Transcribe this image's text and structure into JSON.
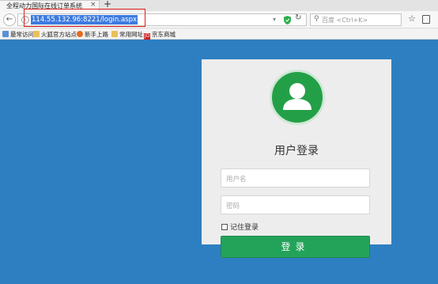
{
  "browser": {
    "tab_title": "全程动力国际在线订单系统",
    "tab_close": "×",
    "new_tab": "+",
    "url": "114.55.132.96:8221/login.aspx",
    "search_placeholder": "百度 <Ctrl+K>",
    "icons": [
      "back-arrow-icon",
      "info-icon",
      "dropdown-icon",
      "shield-icon",
      "reload-icon",
      "search-icon",
      "star-icon",
      "clipboard-icon"
    ]
  },
  "bookmarks": [
    {
      "label": "最常访问",
      "icon": "doc"
    },
    {
      "label": "火狐官方站点",
      "icon": "folder"
    },
    {
      "label": "新手上路",
      "icon": "fox"
    },
    {
      "label": "常用网址",
      "icon": "folder"
    },
    {
      "label": "京东商城",
      "icon": "jd"
    }
  ],
  "login": {
    "title": "用户登录",
    "username_placeholder": "用户名",
    "password_placeholder": "密码",
    "remember_label": "记住登录",
    "submit_label": "登录"
  },
  "colors": {
    "page_bg": "#2e7fc1",
    "card_bg": "#ededed",
    "accent_green": "#23a35a",
    "highlight_red": "#e02020"
  }
}
